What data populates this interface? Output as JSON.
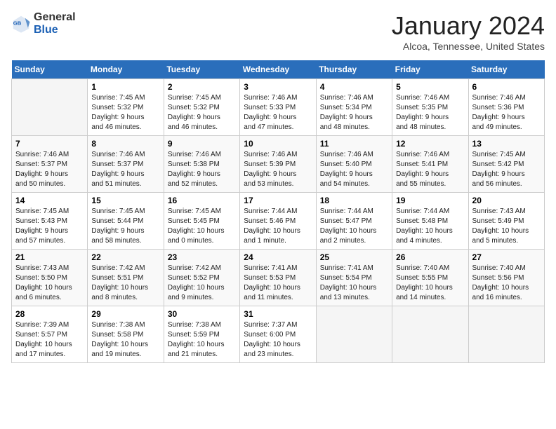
{
  "header": {
    "logo_general": "General",
    "logo_blue": "Blue",
    "month": "January 2024",
    "location": "Alcoa, Tennessee, United States"
  },
  "days_of_week": [
    "Sunday",
    "Monday",
    "Tuesday",
    "Wednesday",
    "Thursday",
    "Friday",
    "Saturday"
  ],
  "weeks": [
    [
      {
        "day": "",
        "info": ""
      },
      {
        "day": "1",
        "info": "Sunrise: 7:45 AM\nSunset: 5:32 PM\nDaylight: 9 hours\nand 46 minutes."
      },
      {
        "day": "2",
        "info": "Sunrise: 7:45 AM\nSunset: 5:32 PM\nDaylight: 9 hours\nand 46 minutes."
      },
      {
        "day": "3",
        "info": "Sunrise: 7:46 AM\nSunset: 5:33 PM\nDaylight: 9 hours\nand 47 minutes."
      },
      {
        "day": "4",
        "info": "Sunrise: 7:46 AM\nSunset: 5:34 PM\nDaylight: 9 hours\nand 48 minutes."
      },
      {
        "day": "5",
        "info": "Sunrise: 7:46 AM\nSunset: 5:35 PM\nDaylight: 9 hours\nand 48 minutes."
      },
      {
        "day": "6",
        "info": "Sunrise: 7:46 AM\nSunset: 5:36 PM\nDaylight: 9 hours\nand 49 minutes."
      }
    ],
    [
      {
        "day": "7",
        "info": "Sunrise: 7:46 AM\nSunset: 5:37 PM\nDaylight: 9 hours\nand 50 minutes."
      },
      {
        "day": "8",
        "info": "Sunrise: 7:46 AM\nSunset: 5:37 PM\nDaylight: 9 hours\nand 51 minutes."
      },
      {
        "day": "9",
        "info": "Sunrise: 7:46 AM\nSunset: 5:38 PM\nDaylight: 9 hours\nand 52 minutes."
      },
      {
        "day": "10",
        "info": "Sunrise: 7:46 AM\nSunset: 5:39 PM\nDaylight: 9 hours\nand 53 minutes."
      },
      {
        "day": "11",
        "info": "Sunrise: 7:46 AM\nSunset: 5:40 PM\nDaylight: 9 hours\nand 54 minutes."
      },
      {
        "day": "12",
        "info": "Sunrise: 7:46 AM\nSunset: 5:41 PM\nDaylight: 9 hours\nand 55 minutes."
      },
      {
        "day": "13",
        "info": "Sunrise: 7:45 AM\nSunset: 5:42 PM\nDaylight: 9 hours\nand 56 minutes."
      }
    ],
    [
      {
        "day": "14",
        "info": "Sunrise: 7:45 AM\nSunset: 5:43 PM\nDaylight: 9 hours\nand 57 minutes."
      },
      {
        "day": "15",
        "info": "Sunrise: 7:45 AM\nSunset: 5:44 PM\nDaylight: 9 hours\nand 58 minutes."
      },
      {
        "day": "16",
        "info": "Sunrise: 7:45 AM\nSunset: 5:45 PM\nDaylight: 10 hours\nand 0 minutes."
      },
      {
        "day": "17",
        "info": "Sunrise: 7:44 AM\nSunset: 5:46 PM\nDaylight: 10 hours\nand 1 minute."
      },
      {
        "day": "18",
        "info": "Sunrise: 7:44 AM\nSunset: 5:47 PM\nDaylight: 10 hours\nand 2 minutes."
      },
      {
        "day": "19",
        "info": "Sunrise: 7:44 AM\nSunset: 5:48 PM\nDaylight: 10 hours\nand 4 minutes."
      },
      {
        "day": "20",
        "info": "Sunrise: 7:43 AM\nSunset: 5:49 PM\nDaylight: 10 hours\nand 5 minutes."
      }
    ],
    [
      {
        "day": "21",
        "info": "Sunrise: 7:43 AM\nSunset: 5:50 PM\nDaylight: 10 hours\nand 6 minutes."
      },
      {
        "day": "22",
        "info": "Sunrise: 7:42 AM\nSunset: 5:51 PM\nDaylight: 10 hours\nand 8 minutes."
      },
      {
        "day": "23",
        "info": "Sunrise: 7:42 AM\nSunset: 5:52 PM\nDaylight: 10 hours\nand 9 minutes."
      },
      {
        "day": "24",
        "info": "Sunrise: 7:41 AM\nSunset: 5:53 PM\nDaylight: 10 hours\nand 11 minutes."
      },
      {
        "day": "25",
        "info": "Sunrise: 7:41 AM\nSunset: 5:54 PM\nDaylight: 10 hours\nand 13 minutes."
      },
      {
        "day": "26",
        "info": "Sunrise: 7:40 AM\nSunset: 5:55 PM\nDaylight: 10 hours\nand 14 minutes."
      },
      {
        "day": "27",
        "info": "Sunrise: 7:40 AM\nSunset: 5:56 PM\nDaylight: 10 hours\nand 16 minutes."
      }
    ],
    [
      {
        "day": "28",
        "info": "Sunrise: 7:39 AM\nSunset: 5:57 PM\nDaylight: 10 hours\nand 17 minutes."
      },
      {
        "day": "29",
        "info": "Sunrise: 7:38 AM\nSunset: 5:58 PM\nDaylight: 10 hours\nand 19 minutes."
      },
      {
        "day": "30",
        "info": "Sunrise: 7:38 AM\nSunset: 5:59 PM\nDaylight: 10 hours\nand 21 minutes."
      },
      {
        "day": "31",
        "info": "Sunrise: 7:37 AM\nSunset: 6:00 PM\nDaylight: 10 hours\nand 23 minutes."
      },
      {
        "day": "",
        "info": ""
      },
      {
        "day": "",
        "info": ""
      },
      {
        "day": "",
        "info": ""
      }
    ]
  ]
}
